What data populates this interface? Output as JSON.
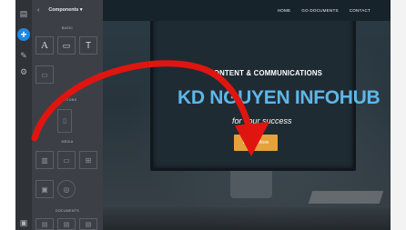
{
  "panel": {
    "back_icon": "‹",
    "title": "Components ▾",
    "sections": {
      "basic": "BASIC",
      "sections": "SECTIONS",
      "media": "MEDIA",
      "documents": "DOCUMENTS"
    },
    "basic_tiles": [
      "A",
      "▭",
      "T"
    ],
    "accent_color": "#1e88e5"
  },
  "rail": {
    "icons": [
      "layers-icon",
      "add-icon",
      "brush-icon",
      "settings-icon",
      "code-icon"
    ]
  },
  "site": {
    "nav": [
      "HOME",
      "GO DOCUMENTS",
      "CONTACT"
    ],
    "hero_sub": "CONTENT & COMMUNICATIONS",
    "hero_title": "KD NGUYEN INFOHUB",
    "hero_tag": "for your success",
    "cta_label": "Learn More",
    "title_color": "#5fb7e8",
    "cta_color": "#e6a23a"
  },
  "annotation": {
    "arrow_color": "#e0150f",
    "arrow_icon": "curved-arrow-icon"
  }
}
